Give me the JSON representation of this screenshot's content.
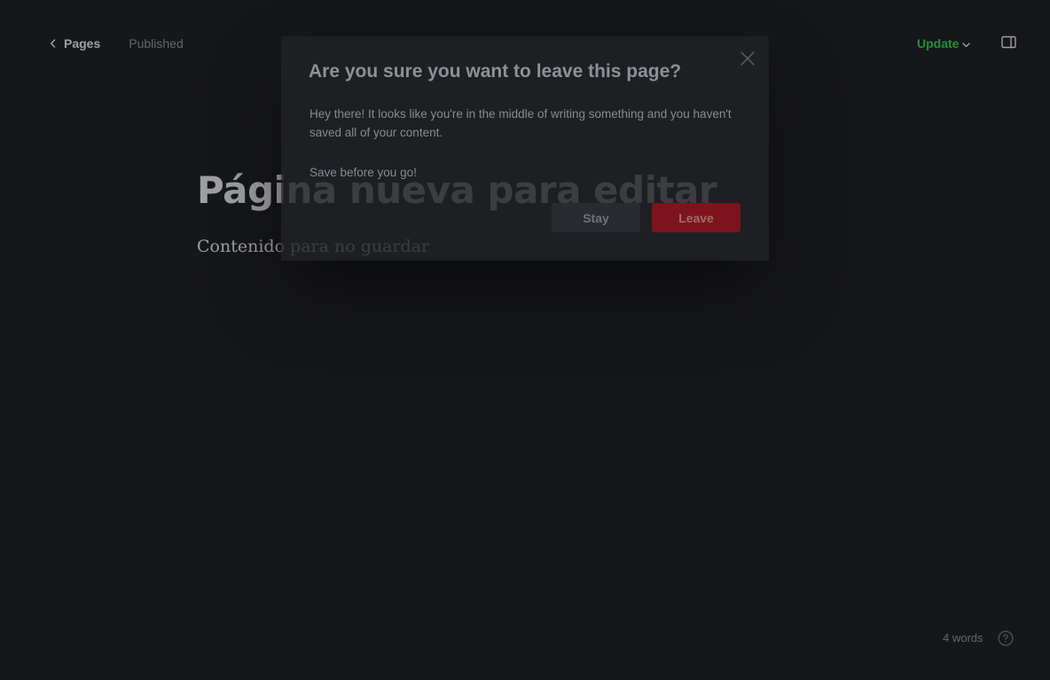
{
  "header": {
    "back_label": "Pages",
    "status": "Published",
    "update_label": "Update"
  },
  "editor": {
    "title": "Página nueva para editar",
    "body": "Contenido para no guardar"
  },
  "footer": {
    "word_count": "4 words"
  },
  "modal": {
    "title": "Are you sure you want to leave this page?",
    "message": "Hey there! It looks like you're in the middle of writing something and you haven't saved all of your content.",
    "message2": "Save before you go!",
    "stay_label": "Stay",
    "leave_label": "Leave"
  },
  "colors": {
    "background": "#16171b",
    "accent_green": "#30cf43",
    "danger_red": "#7d141c"
  },
  "icons": [
    "chevron-left-icon",
    "chevron-down-icon",
    "sidebar-panel-icon",
    "help-icon",
    "close-icon"
  ]
}
